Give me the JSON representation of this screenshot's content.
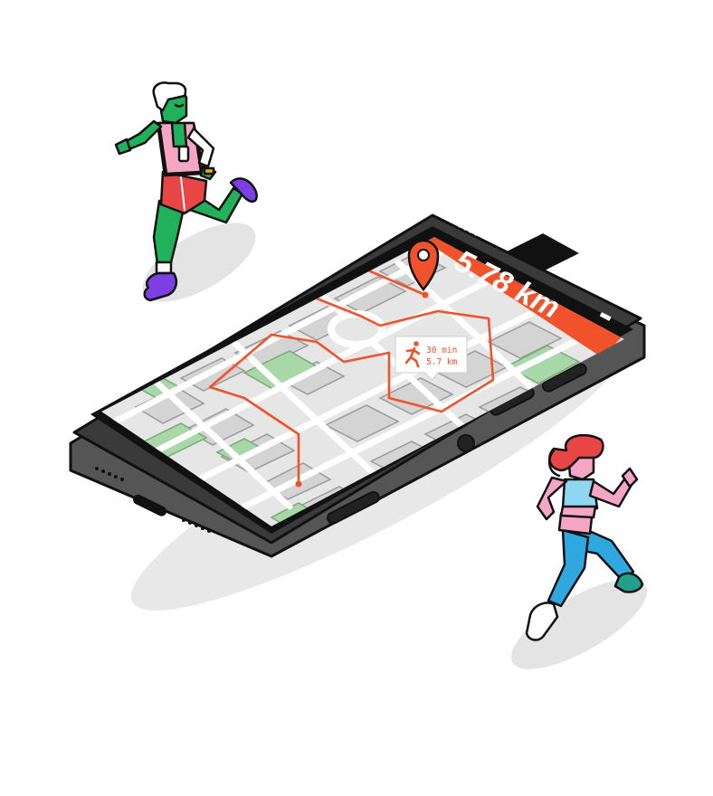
{
  "phone": {
    "distance_label": "5.78 km",
    "tooltip": {
      "time": "30 min",
      "distance": "5.7 km",
      "icon": "runner-icon"
    },
    "pin_icon": "map-pin-icon"
  },
  "colors": {
    "accent": "#f0522b",
    "map_bg": "#e6e6e6",
    "park": "#a8d8a8",
    "road": "#ffffff",
    "phone_body": "#3a3a3a",
    "outline": "#111111",
    "runner_one_skin": "#20b15a",
    "runner_one_vest": "#f4a6c4",
    "runner_one_shorts": "#e84545",
    "runner_one_shoes": "#7b3fe4",
    "runner_two_skin": "#f4a6c4",
    "runner_two_top": "#8fd6f0",
    "runner_two_leggings": "#2fa8e0",
    "runner_two_hair": "#e84545",
    "runner_two_shoes": "#23a08a"
  }
}
